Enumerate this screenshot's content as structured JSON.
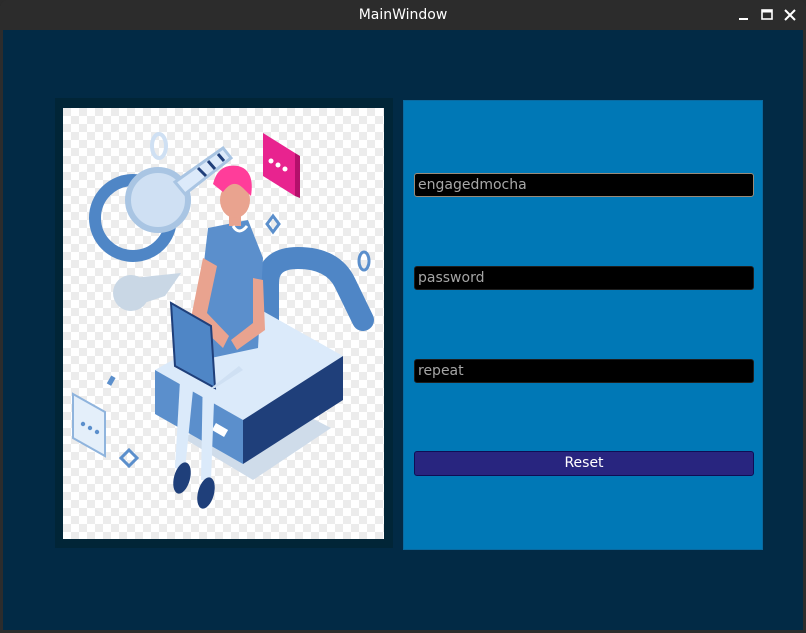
{
  "window": {
    "title": "MainWindow"
  },
  "form": {
    "username_value": "engagedmocha",
    "password_placeholder": "password",
    "repeat_placeholder": "repeat",
    "reset_label": "Reset"
  },
  "icons": {
    "minimize": "minimize-icon",
    "maximize": "maximize-icon",
    "close": "close-icon",
    "illustration": "security-login-illustration"
  },
  "colors": {
    "background": "#022a45",
    "panel": "#0078b6",
    "field": "#000000",
    "button": "#28257f"
  }
}
